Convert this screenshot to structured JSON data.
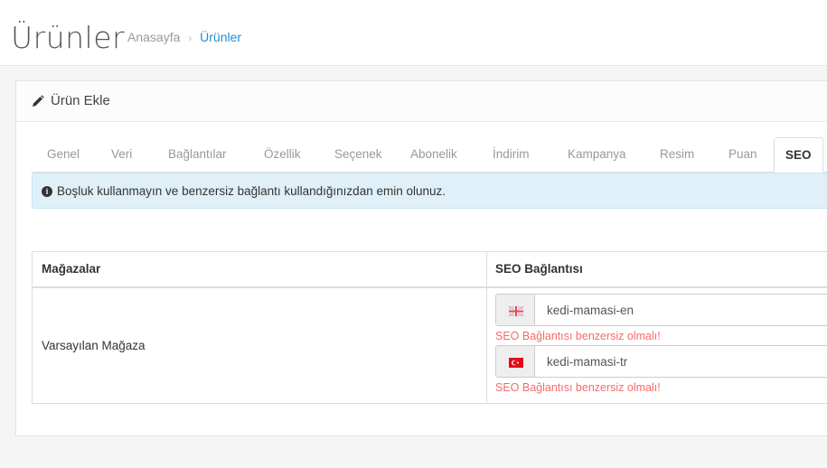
{
  "header": {
    "title": "Ürünler",
    "breadcrumb": {
      "home": "Anasayfa",
      "separator": "›",
      "current": "Ürünler"
    }
  },
  "panel": {
    "icon": "pencil-icon",
    "title": "Ürün Ekle"
  },
  "tabs": [
    {
      "label": "Genel"
    },
    {
      "label": "Veri"
    },
    {
      "label": "Bağlantılar"
    },
    {
      "label": "Özellik"
    },
    {
      "label": "Seçenek"
    },
    {
      "label": "Abonelik"
    },
    {
      "label": "İndirim"
    },
    {
      "label": "Kampanya"
    },
    {
      "label": "Resim"
    },
    {
      "label": "Puan"
    },
    {
      "label": "SEO",
      "active": true
    }
  ],
  "alert": {
    "icon": "info-circle-icon",
    "text": "Boşluk kullanmayın ve benzersiz bağlantı kullandığınızdan emin olunuz."
  },
  "table": {
    "columns": [
      "Mağazalar",
      "SEO Bağlantısı"
    ],
    "rows": [
      {
        "store": "Varsayılan Mağaza",
        "entries": [
          {
            "flag": "gb-flag-icon",
            "value": "kedi-mamasi-en",
            "error": "SEO Bağlantısı benzersiz olmalı!"
          },
          {
            "flag": "tr-flag-icon",
            "value": "kedi-mamasi-tr",
            "error": "SEO Bağlantısı benzersiz olmalı!"
          }
        ]
      }
    ]
  },
  "colors": {
    "accent": "#1e91cf",
    "error": "#f56b6b",
    "alert_bg": "#dff0f8"
  }
}
